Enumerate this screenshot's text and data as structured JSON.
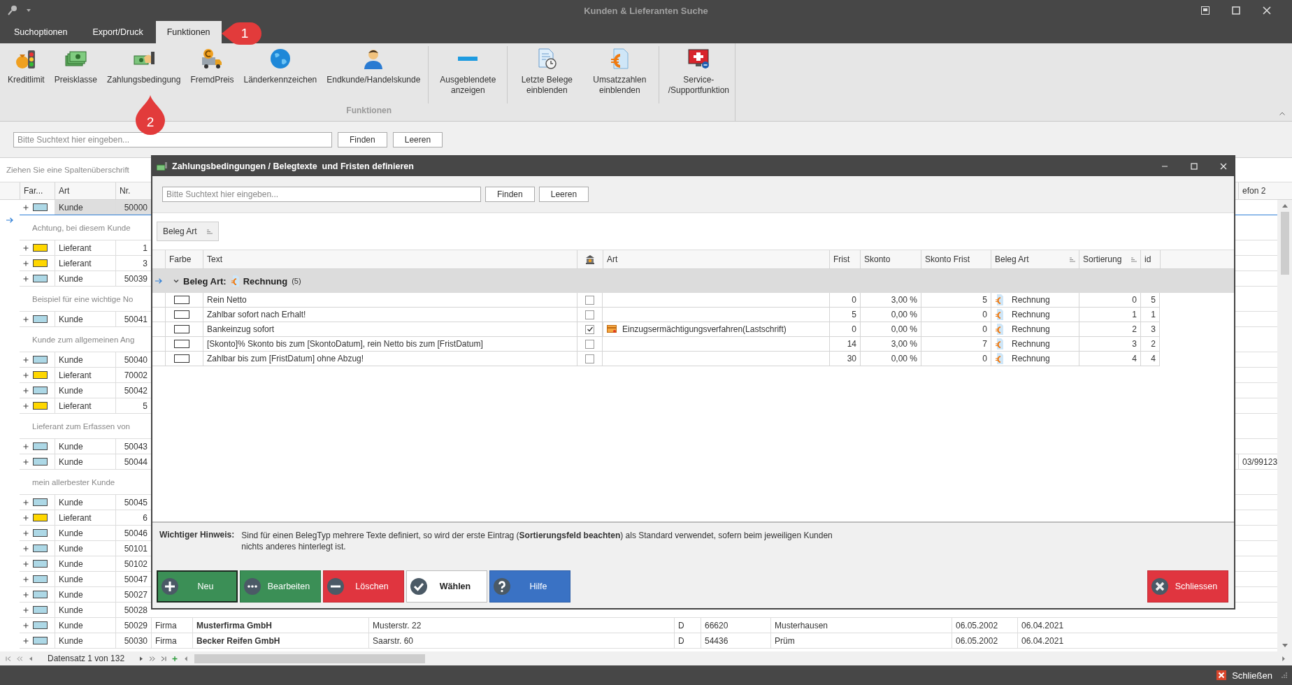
{
  "window": {
    "title": "Kunden & Lieferanten Suche"
  },
  "tabs": [
    {
      "label": "Suchoptionen",
      "selected": false
    },
    {
      "label": "Export/Druck",
      "selected": false
    },
    {
      "label": "Funktionen",
      "selected": true
    }
  ],
  "callouts": [
    {
      "label": "1"
    },
    {
      "label": "2"
    }
  ],
  "ribbon": {
    "group_label": "Funktionen",
    "sections": [
      {
        "items": [
          {
            "label": "Kreditlimit",
            "kind": "limit"
          },
          {
            "label": "Preisklasse",
            "kind": "banknotes"
          },
          {
            "label": "Zahlungsbedingung",
            "kind": "payment"
          },
          {
            "label": "FremdPreis",
            "kind": "truck"
          },
          {
            "label": "Länderkennzeichen",
            "kind": "globe"
          },
          {
            "label": "Endkunde/Handelskunde",
            "kind": "person"
          }
        ]
      },
      {
        "items": [
          {
            "label": "Ausgeblendete anzeigen",
            "kind": "minus"
          }
        ]
      },
      {
        "items": [
          {
            "label": "Letzte Belege einblenden",
            "kind": "docclock"
          },
          {
            "label": "Umsatzzahlen einblenden",
            "kind": "doceuro"
          }
        ]
      },
      {
        "items": [
          {
            "label": "Service- /Supportfunktion",
            "kind": "support"
          }
        ]
      }
    ]
  },
  "search": {
    "placeholder": "Bitte Suchtext hier eingeben...",
    "buttons": [
      "Finden",
      "Leeren"
    ]
  },
  "group_panel": {
    "hint": "Ziehen Sie eine Spaltenüberschrift"
  },
  "grid": {
    "columns": [
      "Far...",
      "Art",
      "Nr."
    ],
    "right_column": "efon 2",
    "rows": [
      {
        "color": "#add8e6",
        "art": "Kunde",
        "nr": "50000",
        "current": true,
        "note": "Achtung, bei diesem Kunde"
      },
      {
        "color": "#ffd700",
        "art": "Lieferant",
        "nr": "1",
        "current": false
      },
      {
        "color": "#ffd700",
        "art": "Lieferant",
        "nr": "3",
        "current": false
      },
      {
        "color": "#add8e6",
        "art": "Kunde",
        "nr": "50039",
        "current": false,
        "note": "Beispiel für eine wichtige No"
      },
      {
        "color": "#add8e6",
        "art": "Kunde",
        "nr": "50041",
        "current": false,
        "note": "Kunde zum allgemeinen Ang"
      },
      {
        "color": "#add8e6",
        "art": "Kunde",
        "nr": "50040",
        "current": false
      },
      {
        "color": "#ffd700",
        "art": "Lieferant",
        "nr": "70002",
        "current": false
      },
      {
        "color": "#add8e6",
        "art": "Kunde",
        "nr": "50042",
        "current": false
      },
      {
        "color": "#ffd700",
        "art": "Lieferant",
        "nr": "5",
        "current": false,
        "note": "Lieferant zum Erfassen von"
      },
      {
        "color": "#add8e6",
        "art": "Kunde",
        "nr": "50043",
        "current": false
      },
      {
        "color": "#add8e6",
        "art": "Kunde",
        "nr": "50044",
        "current": false,
        "telefon_2": "03/99123",
        "note": "mein allerbester Kunde"
      },
      {
        "color": "#add8e6",
        "art": "Kunde",
        "nr": "50045",
        "current": false
      },
      {
        "color": "#ffd700",
        "art": "Lieferant",
        "nr": "6",
        "current": false
      },
      {
        "color": "#add8e6",
        "art": "Kunde",
        "nr": "50046",
        "current": false
      },
      {
        "color": "#add8e6",
        "art": "Kunde",
        "nr": "50101",
        "current": false
      },
      {
        "color": "#add8e6",
        "art": "Kunde",
        "nr": "50102",
        "current": false
      },
      {
        "color": "#add8e6",
        "art": "Kunde",
        "nr": "50047",
        "current": false
      },
      {
        "color": "#add8e6",
        "art": "Kunde",
        "nr": "50027",
        "current": false
      },
      {
        "color": "#add8e6",
        "art": "Kunde",
        "nr": "50028",
        "current": false
      },
      {
        "color": "#add8e6",
        "art": "Kunde",
        "nr": "50029",
        "current": false,
        "wide": {
          "column_4": "Firma",
          "column_5": "Musterfirma GmbH",
          "column_7": "Musterstr. 22",
          "column_9": "D",
          "column_10": "66620",
          "column_11": "Musterhausen",
          "column_13": "06.05.2002",
          "column_14": "06.04.2021"
        }
      },
      {
        "color": "#add8e6",
        "art": "Kunde",
        "nr": "50030",
        "current": false,
        "wide": {
          "column_4": "Firma",
          "column_5": "Becker Reifen GmbH",
          "column_7": "Saarstr. 60",
          "column_9": "D",
          "column_10": "54436",
          "column_11": "Prüm",
          "column_13": "06.05.2002",
          "column_14": "06.04.2021"
        }
      }
    ],
    "navigator": "Datensatz 1 von 132"
  },
  "dialog": {
    "title": "Zahlungsbedingungen / Belegtexte  und Fristen definieren",
    "search": {
      "placeholder": "Bitte Suchtext hier eingeben...",
      "buttons": [
        "Finden",
        "Leeren"
      ]
    },
    "group_chip": "Beleg Art",
    "table": {
      "columns": [
        {
          "kind": "text",
          "label": "Farbe",
          "sorted": false
        },
        {
          "kind": "text",
          "label": "Text",
          "sorted": false
        },
        {
          "kind": "icon",
          "sorted": false
        },
        {
          "kind": "text",
          "label": "Art",
          "sorted": false
        },
        {
          "kind": "text",
          "label": "Frist",
          "sorted": false
        },
        {
          "kind": "text",
          "label": "Skonto",
          "sorted": false
        },
        {
          "kind": "text",
          "label": "Skonto Frist",
          "sorted": false
        },
        {
          "kind": "text",
          "label": "Beleg Art",
          "sorted": true
        },
        {
          "kind": "text",
          "label": "Sortierung",
          "sorted": true
        },
        {
          "kind": "text",
          "label": "id",
          "sorted": false
        }
      ],
      "group": {
        "label": "Beleg Art:",
        "value": "Rechnung",
        "count": "(5)",
        "expanded": true,
        "current": true
      },
      "rows": [
        {
          "text": "Rein Netto",
          "checked": false,
          "frist": "0",
          "skonto": "3,00 %",
          "skonto_frist": "5",
          "beleg_art": "Rechnung",
          "sortierung": "0",
          "id": "5"
        },
        {
          "text": "Zahlbar sofort nach Erhalt!",
          "checked": false,
          "frist": "5",
          "skonto": "0,00 %",
          "skonto_frist": "0",
          "beleg_art": "Rechnung",
          "sortierung": "1",
          "id": "1"
        },
        {
          "text": "Bankeinzug sofort",
          "checked": true,
          "art": "Einzugsermächtigungsverfahren(Lastschrift)",
          "frist": "0",
          "skonto": "0,00 %",
          "skonto_frist": "0",
          "beleg_art": "Rechnung",
          "sortierung": "2",
          "id": "3"
        },
        {
          "text": "[Skonto]% Skonto bis zum [SkontoDatum], rein Netto bis zum  [FristDatum]",
          "checked": false,
          "frist": "14",
          "skonto": "3,00 %",
          "skonto_frist": "7",
          "beleg_art": "Rechnung",
          "sortierung": "3",
          "id": "2"
        },
        {
          "text": "Zahlbar bis zum [FristDatum] ohne Abzug!",
          "checked": false,
          "frist": "30",
          "skonto": "0,00 %",
          "skonto_frist": "0",
          "beleg_art": "Rechnung",
          "sortierung": "4",
          "id": "4"
        }
      ]
    },
    "hint": {
      "label": "Wichtiger Hinweis:",
      "text": "Sind für einen BelegTyp mehrere Texte definiert, so wird der erste Eintrag (**Sortierungsfeld beachten**) als Standard verwendet, sofern beim jeweiligen Kunden nichts anderes hinterlegt ist."
    },
    "buttons": [
      {
        "label": "Neu",
        "kind": "add",
        "focused": true
      },
      {
        "label": "Bearbeiten",
        "kind": "edit",
        "focused": false
      },
      {
        "label": "Löschen",
        "kind": "delete",
        "focused": false
      },
      {
        "label": "Wählen",
        "kind": "choose",
        "focused": false
      },
      {
        "label": "Hilfe",
        "kind": "help",
        "focused": false
      }
    ],
    "close_button": {
      "label": "Schliessen",
      "kind": "close"
    }
  },
  "status_bar": {
    "close_label": "Schließen"
  }
}
